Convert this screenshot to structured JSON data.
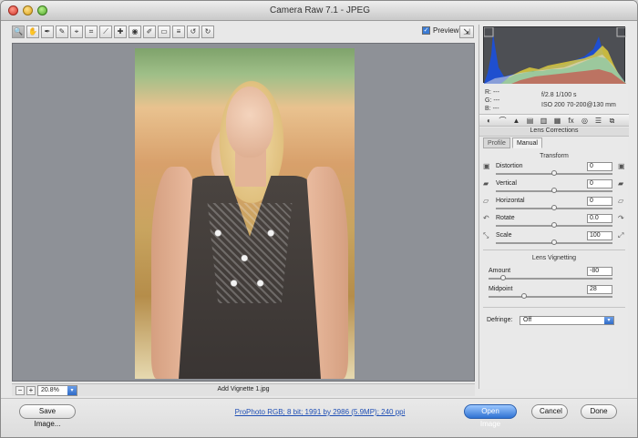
{
  "window": {
    "title": "Camera Raw 7.1  -  JPEG"
  },
  "toolbar": {
    "tools": [
      {
        "icon": "zoom-tool-icon",
        "glyph": "🔍",
        "active": true
      },
      {
        "icon": "hand-tool-icon",
        "glyph": "✋",
        "active": false
      },
      {
        "icon": "white-balance-tool-icon",
        "glyph": "✒",
        "active": false
      },
      {
        "icon": "color-sampler-tool-icon",
        "glyph": "✎",
        "active": false
      },
      {
        "icon": "targeted-adjustment-tool-icon",
        "glyph": "⌖",
        "active": false
      },
      {
        "icon": "crop-tool-icon",
        "glyph": "⌗",
        "active": false
      },
      {
        "icon": "straighten-tool-icon",
        "glyph": "⟋",
        "active": false
      },
      {
        "icon": "spot-removal-tool-icon",
        "glyph": "✚",
        "active": false
      },
      {
        "icon": "red-eye-tool-icon",
        "glyph": "◉",
        "active": false
      },
      {
        "icon": "adjustment-brush-tool-icon",
        "glyph": "✐",
        "active": false
      },
      {
        "icon": "graduated-filter-tool-icon",
        "glyph": "▭",
        "active": false
      },
      {
        "icon": "preferences-icon",
        "glyph": "≡",
        "active": false
      },
      {
        "icon": "rotate-left-icon",
        "glyph": "↺",
        "active": false
      },
      {
        "icon": "rotate-right-icon",
        "glyph": "↻",
        "active": false
      }
    ],
    "preview_label": "Preview",
    "preview_checked": true,
    "fullscreen_icon": "fullscreen-icon"
  },
  "status": {
    "zoom_value": "20.8%",
    "filename": "Add Vignette 1.jpg"
  },
  "readouts": {
    "r_label": "R:",
    "g_label": "G:",
    "b_label": "B:",
    "r_value": "---",
    "g_value": "---",
    "b_value": "---",
    "aperture_shutter": "f/2.8   1/100 s",
    "iso_lens": "ISO 200   70-200@130 mm"
  },
  "panel": {
    "icons": [
      "basic-icon",
      "tone-curve-icon",
      "detail-icon",
      "hsl-icon",
      "split-toning-icon",
      "lens-corrections-icon",
      "effects-icon",
      "camera-calibration-icon",
      "presets-icon",
      "snapshots-icon"
    ],
    "section_title": "Lens Corrections",
    "tabs": [
      "Profile",
      "Manual"
    ],
    "active_tab": "Manual",
    "transform_title": "Transform",
    "transform": [
      {
        "label": "Distortion",
        "value": "0",
        "position": 0.5
      },
      {
        "label": "Vertical",
        "value": "0",
        "position": 0.5
      },
      {
        "label": "Horizontal",
        "value": "0",
        "position": 0.5
      },
      {
        "label": "Rotate",
        "value": "0.0",
        "position": 0.5
      },
      {
        "label": "Scale",
        "value": "100",
        "position": 0.5
      }
    ],
    "vignetting_title": "Lens Vignetting",
    "vignetting": [
      {
        "label": "Amount",
        "value": "-80",
        "position": 0.1
      },
      {
        "label": "Midpoint",
        "value": "28",
        "position": 0.28
      }
    ],
    "defringe_label": "Defringe:",
    "defringe_value": "Off"
  },
  "footer": {
    "save_label": "Save Image...",
    "workflow_link": "ProPhoto RGB; 8 bit; 1991 by 2986 (5.9MP); 240 ppi",
    "open_label": "Open Image",
    "cancel_label": "Cancel",
    "done_label": "Done"
  },
  "colors": {
    "accent": "#2e72d2"
  }
}
